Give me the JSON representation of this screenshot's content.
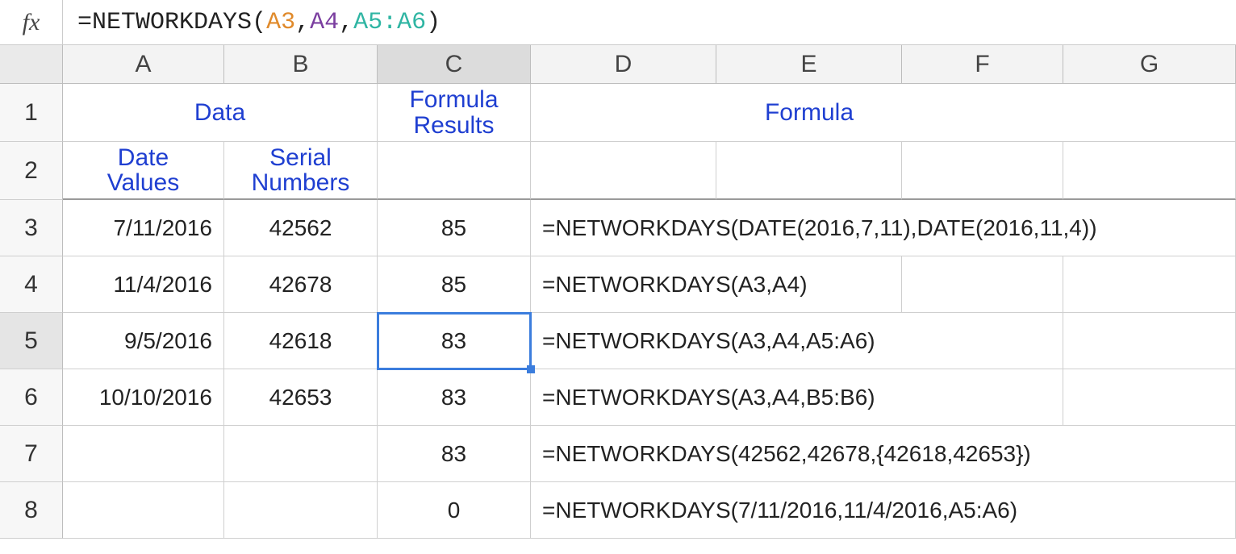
{
  "formula_bar": {
    "fx_label": "fx",
    "tokens": {
      "eq": "=",
      "fn": "NETWORKDAYS",
      "open": "(",
      "a3": "A3",
      "c1": ",",
      "a4": "A4",
      "c2": ",",
      "rng": "A5:A6",
      "close": ")"
    }
  },
  "columns": {
    "A": "A",
    "B": "B",
    "C": "C",
    "D": "D",
    "E": "E",
    "F": "F",
    "G": "G"
  },
  "row_labels": {
    "r1": "1",
    "r2": "2",
    "r3": "3",
    "r4": "4",
    "r5": "5",
    "r6": "6",
    "r7": "7",
    "r8": "8"
  },
  "headers": {
    "data_label": "Data",
    "formula_results_line1": "Formula",
    "formula_results_line2": "Results",
    "formula_label": "Formula",
    "date_values_line1": "Date",
    "date_values_line2": "Values",
    "serial_numbers_line1": "Serial",
    "serial_numbers_line2": "Numbers"
  },
  "cells": {
    "A3": "7/11/2016",
    "B3": "42562",
    "C3": "85",
    "D3": "=NETWORKDAYS(DATE(2016,7,11),DATE(2016,11,4))",
    "A4": "11/4/2016",
    "B4": "42678",
    "C4": "85",
    "D4": "=NETWORKDAYS(A3,A4)",
    "A5": "9/5/2016",
    "B5": "42618",
    "C5": "83",
    "D5": "=NETWORKDAYS(A3,A4,A5:A6)",
    "A6": "10/10/2016",
    "B6": "42653",
    "C6": "83",
    "D6": "=NETWORKDAYS(A3,A4,B5:B6)",
    "C7": "83",
    "D7": "=NETWORKDAYS(42562,42678,{42618,42653})",
    "C8": "0",
    "D8": "=NETWORKDAYS(7/11/2016,11/4/2016,A5:A6)"
  },
  "active_cell": "C5"
}
